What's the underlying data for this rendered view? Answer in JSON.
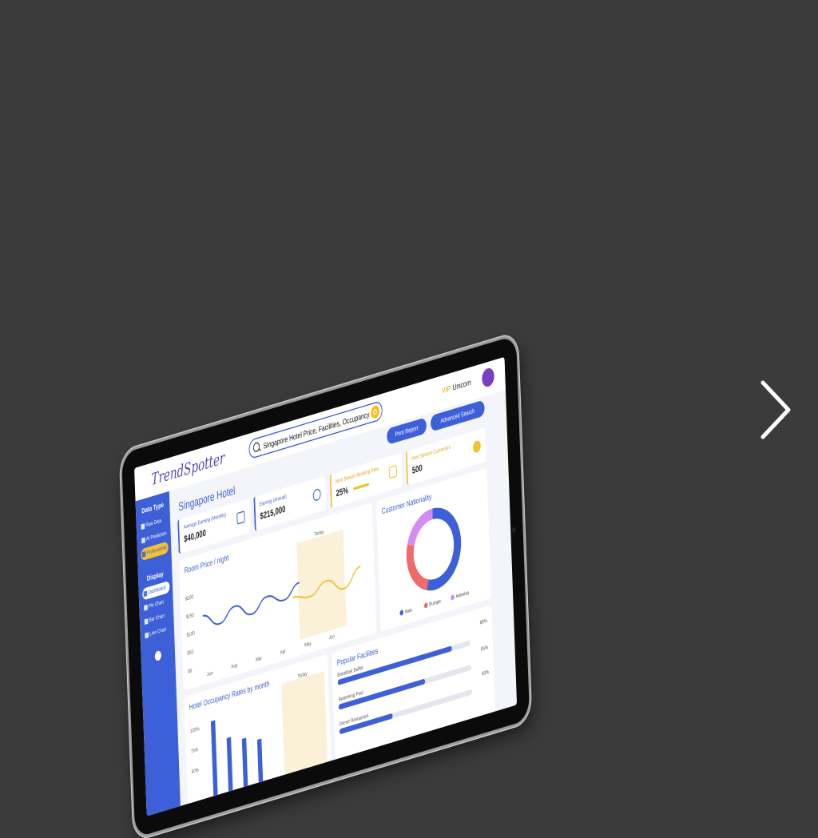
{
  "app": {
    "logo": "TrendSpotter",
    "search_query": "Singapore Hotel Price, Facilities, Occupancy",
    "user_tier": "VIP",
    "user_name": "Unicorn"
  },
  "sidebar": {
    "data_type_heading": "Data Type",
    "data_type_items": [
      {
        "label": "Raw Data"
      },
      {
        "label": "AI Prediction"
      },
      {
        "label": "Professional"
      }
    ],
    "display_heading": "Display",
    "display_items": [
      {
        "label": "Dashboard"
      },
      {
        "label": "Pie Chart"
      },
      {
        "label": "Bar Chart"
      },
      {
        "label": "Line Chart"
      }
    ]
  },
  "actions": {
    "print_report": "Print Report",
    "advanced_search": "Advanced Search"
  },
  "page_title": "Singapore Hotel",
  "kpis": {
    "avg_earning_label": "Average Earning (Monthly)",
    "avg_earning_value": "$40,000",
    "earning_annual_label": "Earning (Annual)",
    "earning_annual_value": "$215,000",
    "booking_rate_label": "Next Season Booking Rate",
    "booking_rate_value": "25%",
    "booking_rate_fraction": 0.25,
    "next_season_customers_label": "Next Season Customers",
    "next_season_customers_value": "500"
  },
  "room_price": {
    "title": "Room Price / night",
    "today_label": "Today",
    "y_ticks": [
      "$200",
      "$150",
      "$100",
      "$50",
      "$0"
    ],
    "x_ticks": [
      "Jan",
      "Feb",
      "Mar",
      "Apr",
      "May",
      "Jun"
    ]
  },
  "nationality": {
    "title": "Customer Nationality",
    "legend": [
      "Asia",
      "Europe",
      "America"
    ]
  },
  "occupancy": {
    "title": "Hotel Occupancy Rates by month",
    "today_label": "Today",
    "y_ticks": [
      "100%",
      "75%",
      "50%"
    ]
  },
  "facilities": {
    "title": "Popular Facilities",
    "items": [
      {
        "label": "Breakfast Buffet",
        "percent": "86%",
        "value": 0.86
      },
      {
        "label": "Swimming Pool",
        "percent": "65%",
        "value": 0.65
      },
      {
        "label": "Dinner Restaurant",
        "percent": "40%",
        "value": 0.4
      }
    ]
  },
  "colors": {
    "primary": "#3d5fd8",
    "accent": "#f2c230",
    "europe": "#f06a6a",
    "america": "#d58cf0",
    "background": "#3b3b3b"
  },
  "chart_data": [
    {
      "type": "line",
      "title": "Room Price / night",
      "categories": [
        "Jan",
        "Feb",
        "Mar",
        "Apr",
        "May",
        "Jun"
      ],
      "series": [
        {
          "values": [
            130,
            100,
            130,
            100,
            130,
            110,
            140
          ]
        },
        {
          "values": [
            110,
            100,
            125,
            95,
            135
          ]
        }
      ],
      "ylim": [
        0,
        200
      ]
    },
    {
      "type": "pie",
      "title": "Customer Nationality",
      "labels": [
        "Asia",
        "Europe",
        "America"
      ],
      "values": [
        55,
        25,
        20
      ]
    },
    {
      "type": "bar",
      "title": "Hotel Occupancy Rates by month",
      "values": [
        100,
        80,
        75,
        70
      ],
      "ylim": [
        50,
        100
      ]
    }
  ]
}
